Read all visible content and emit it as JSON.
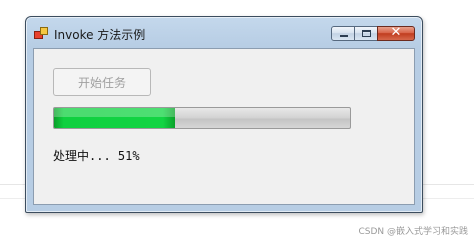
{
  "window": {
    "title": "Invoke 方法示例",
    "close_glyph": "✕"
  },
  "main": {
    "start_button_label": "开始任务",
    "progress_fraction": 0.41,
    "status_text": "处理中... 51%"
  },
  "page": {
    "watermark": "CSDN @嵌入式学习和实践"
  },
  "colors": {
    "progress_fill": "#12d443",
    "client_background": "#f0f0f0"
  }
}
